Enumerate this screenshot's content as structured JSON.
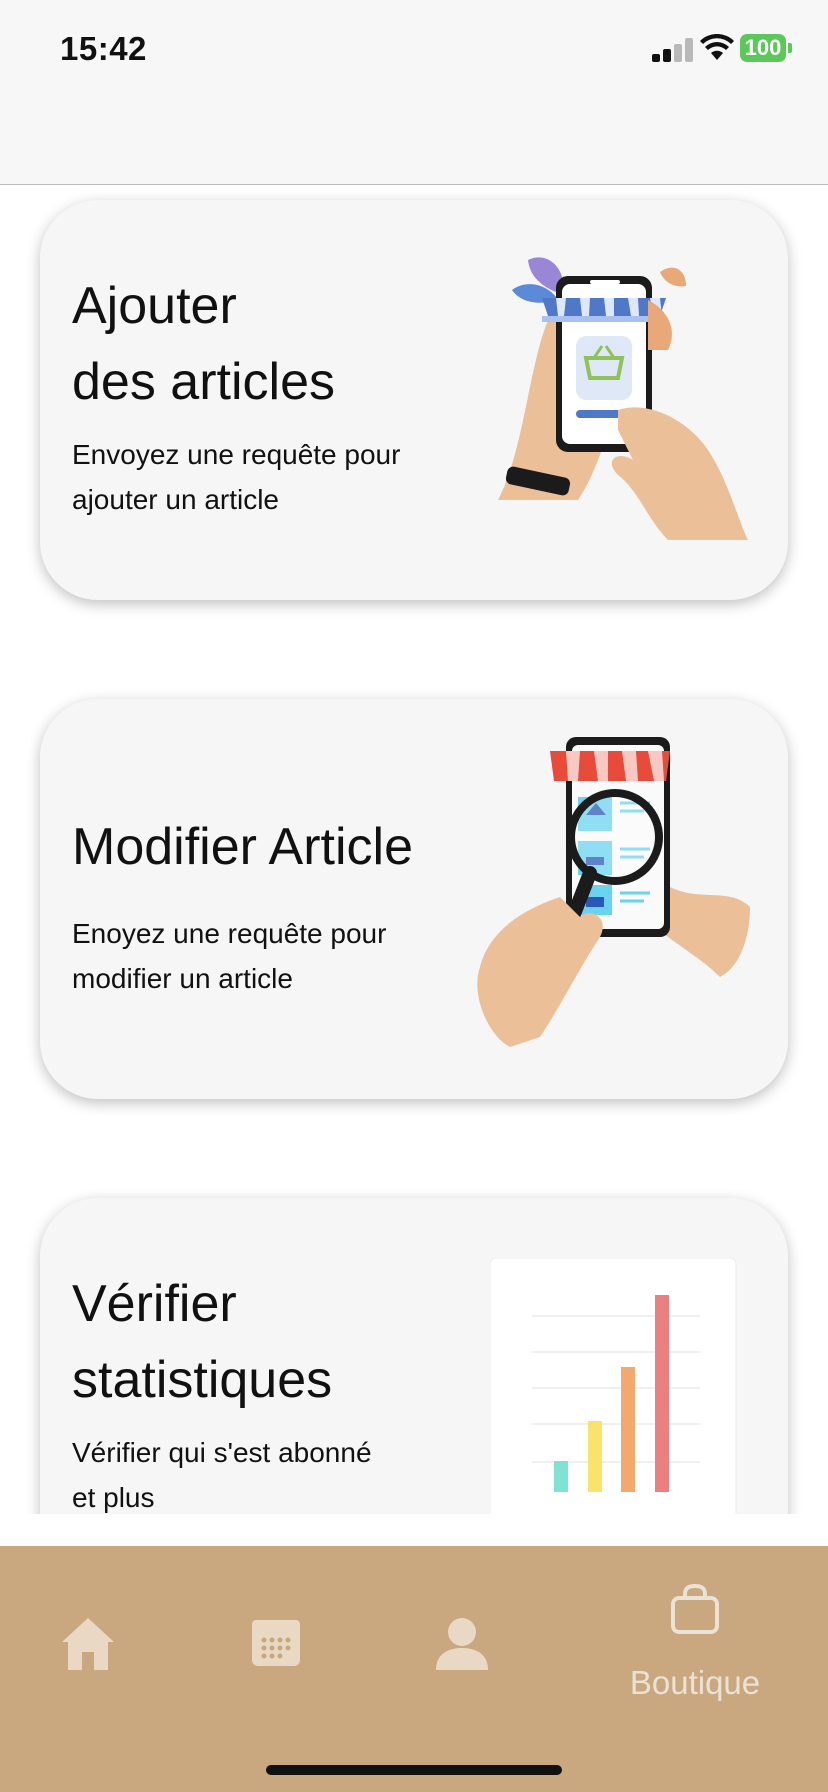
{
  "status_bar": {
    "time": "15:42",
    "battery": "100",
    "battery_color": "#5cc85a"
  },
  "cards": [
    {
      "title_line1": "Ajouter",
      "title_line2": "des articles",
      "desc_line1": "Envoyez une requête pour",
      "desc_line2": "ajouter un article",
      "illustration": "phone-shop-basket-illustration"
    },
    {
      "title_line1": "Modifier Article",
      "desc_line1": "Enoyez une requête pour",
      "desc_line2": "modifier un article",
      "illustration": "phone-magnifier-shop-illustration"
    },
    {
      "title_line1": "Vérifier",
      "title_line2": "statistiques",
      "desc_line1": "Vérifier qui s'est abonné",
      "desc_line2": "et plus",
      "illustration": "bar-chart-illustration"
    }
  ],
  "tab_bar": {
    "background": "#c9a77f",
    "tabs": [
      {
        "icon": "home-icon"
      },
      {
        "icon": "calendar-icon"
      },
      {
        "icon": "person-icon"
      },
      {
        "icon": "shopping-bag-icon",
        "label": "Boutique",
        "active": true
      }
    ]
  }
}
